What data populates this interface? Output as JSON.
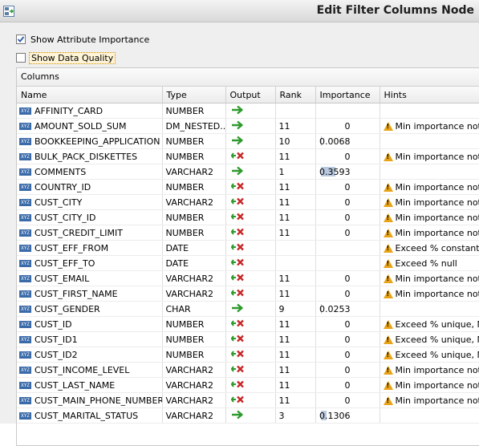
{
  "window": {
    "title": "Edit Filter Columns Node"
  },
  "options": [
    {
      "label": "Show Attribute Importance",
      "checked": true
    },
    {
      "label": "Show Data Quality",
      "checked": false
    }
  ],
  "table": {
    "caption": "Columns",
    "headers": [
      "Name",
      "Type",
      "Output",
      "Rank",
      "Importance",
      "Hints"
    ],
    "rows": [
      {
        "name": "AFFINITY_CARD",
        "type": "NUMBER",
        "output": "include",
        "rank": "",
        "importance": "",
        "hint": ""
      },
      {
        "name": "AMOUNT_SOLD_SUM",
        "type": "DM_NESTED...",
        "output": "include",
        "rank": "11",
        "importance": "0",
        "hint": "Min importance not"
      },
      {
        "name": "BOOKKEEPING_APPLICATION",
        "type": "NUMBER",
        "output": "include",
        "rank": "10",
        "importance": "0.0068",
        "hint": ""
      },
      {
        "name": "BULK_PACK_DISKETTES",
        "type": "NUMBER",
        "output": "exclude",
        "rank": "11",
        "importance": "0",
        "hint": "Min importance not"
      },
      {
        "name": "COMMENTS",
        "type": "VARCHAR2",
        "output": "include",
        "rank": "1",
        "importance": "0.3593",
        "hint": ""
      },
      {
        "name": "COUNTRY_ID",
        "type": "NUMBER",
        "output": "exclude",
        "rank": "11",
        "importance": "0",
        "hint": "Min importance not"
      },
      {
        "name": "CUST_CITY",
        "type": "VARCHAR2",
        "output": "exclude",
        "rank": "11",
        "importance": "0",
        "hint": "Min importance not"
      },
      {
        "name": "CUST_CITY_ID",
        "type": "NUMBER",
        "output": "exclude",
        "rank": "11",
        "importance": "0",
        "hint": "Min importance not"
      },
      {
        "name": "CUST_CREDIT_LIMIT",
        "type": "NUMBER",
        "output": "exclude",
        "rank": "11",
        "importance": "0",
        "hint": "Min importance not"
      },
      {
        "name": "CUST_EFF_FROM",
        "type": "DATE",
        "output": "exclude",
        "rank": "",
        "importance": "",
        "hint": "Exceed % constant"
      },
      {
        "name": "CUST_EFF_TO",
        "type": "DATE",
        "output": "exclude",
        "rank": "",
        "importance": "",
        "hint": "Exceed % null"
      },
      {
        "name": "CUST_EMAIL",
        "type": "VARCHAR2",
        "output": "exclude",
        "rank": "11",
        "importance": "0",
        "hint": "Min importance not"
      },
      {
        "name": "CUST_FIRST_NAME",
        "type": "VARCHAR2",
        "output": "exclude",
        "rank": "11",
        "importance": "0",
        "hint": "Min importance not"
      },
      {
        "name": "CUST_GENDER",
        "type": "CHAR",
        "output": "include",
        "rank": "9",
        "importance": "0.0253",
        "hint": ""
      },
      {
        "name": "CUST_ID",
        "type": "NUMBER",
        "output": "exclude",
        "rank": "11",
        "importance": "0",
        "hint": "Exceed % unique, Min"
      },
      {
        "name": "CUST_ID1",
        "type": "NUMBER",
        "output": "exclude",
        "rank": "11",
        "importance": "0",
        "hint": "Exceed % unique, Min"
      },
      {
        "name": "CUST_ID2",
        "type": "NUMBER",
        "output": "exclude",
        "rank": "11",
        "importance": "0",
        "hint": "Exceed % unique, Min"
      },
      {
        "name": "CUST_INCOME_LEVEL",
        "type": "VARCHAR2",
        "output": "exclude",
        "rank": "11",
        "importance": "0",
        "hint": "Min importance not"
      },
      {
        "name": "CUST_LAST_NAME",
        "type": "VARCHAR2",
        "output": "exclude",
        "rank": "11",
        "importance": "0",
        "hint": "Min importance not"
      },
      {
        "name": "CUST_MAIN_PHONE_NUMBER",
        "type": "VARCHAR2",
        "output": "exclude",
        "rank": "11",
        "importance": "0",
        "hint": "Min importance not"
      },
      {
        "name": "CUST_MARITAL_STATUS",
        "type": "VARCHAR2",
        "output": "include",
        "rank": "3",
        "importance": "0.1306",
        "hint": ""
      }
    ]
  },
  "colors": {
    "include_arrow": "#2e9a2e",
    "exclude_mark": "#c62828",
    "warning": "#e8a317",
    "importance_bar": "#b8c8de"
  },
  "icons": {
    "column_type": "column-type-icon",
    "include": "include-arrow-icon",
    "exclude": "exclude-arrow-icon",
    "warning": "warning-icon"
  }
}
